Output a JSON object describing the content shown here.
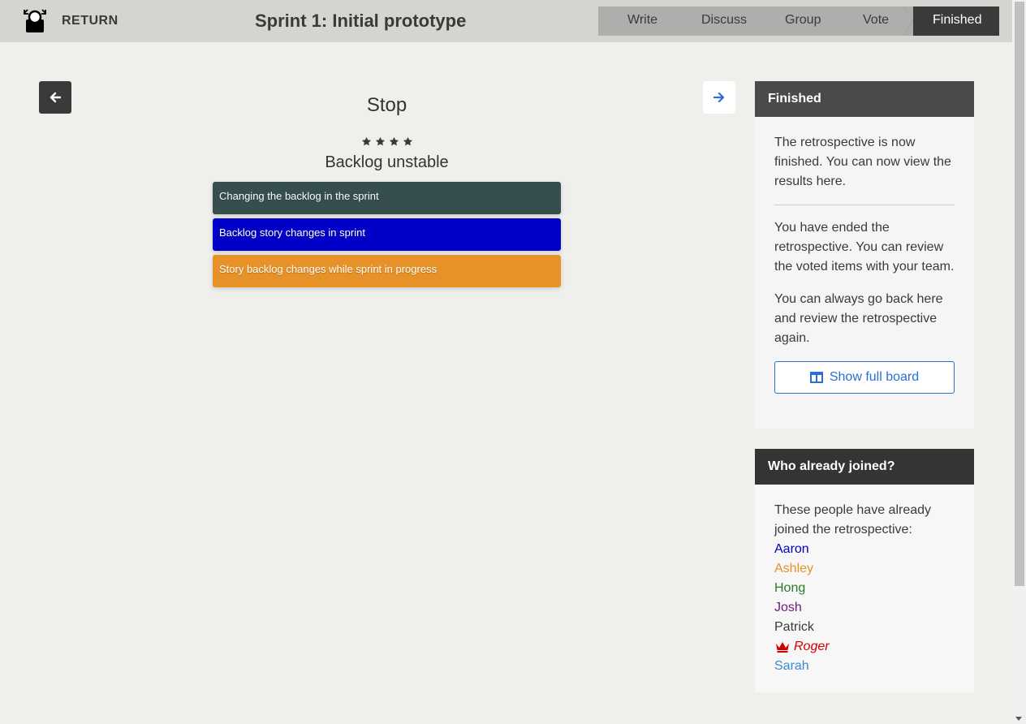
{
  "header": {
    "return_label": "RETURN",
    "sprint_title": "Sprint 1: Initial prototype",
    "steps": [
      "Write",
      "Discuss",
      "Group",
      "Vote",
      "Finished"
    ],
    "active_step": "Finished"
  },
  "main": {
    "column_title": "Stop",
    "star_count": 4,
    "group_title": "Backlog unstable",
    "cards": [
      {
        "text": "Changing the backlog in the sprint",
        "color": "#374e4e"
      },
      {
        "text": "Backlog story changes in sprint",
        "color": "#0000c8"
      },
      {
        "text": "Story backlog changes while sprint in progress",
        "color": "#e69228"
      }
    ]
  },
  "finished_panel": {
    "title": "Finished",
    "intro": "The retrospective is now finished. You can now view the results here.",
    "ended_text": "You have ended the retrospective. You can review the voted items with your team.",
    "go_back_text": "You can always go back here and review the retrospective again.",
    "show_board_label": "Show full board"
  },
  "joined_panel": {
    "title": "Who already joined?",
    "intro": "These people have already joined the retrospective:",
    "members": [
      {
        "name": "Aaron",
        "color": "#0000c8",
        "host": false
      },
      {
        "name": "Ashley",
        "color": "#e69228",
        "host": false
      },
      {
        "name": "Hong",
        "color": "#2a7a2a",
        "host": false
      },
      {
        "name": "Josh",
        "color": "#6b1d7a",
        "host": false
      },
      {
        "name": "Patrick",
        "color": "#3a3a3a",
        "host": false
      },
      {
        "name": "Roger",
        "color": "#d40000",
        "host": true
      },
      {
        "name": "Sarah",
        "color": "#3a8ad6",
        "host": false
      }
    ]
  },
  "colors": {
    "accent": "#2b6fd6",
    "topbar": "#d4d4d0",
    "steps_bg": "#aeaeac",
    "active_step_bg": "#3a3a3a"
  }
}
